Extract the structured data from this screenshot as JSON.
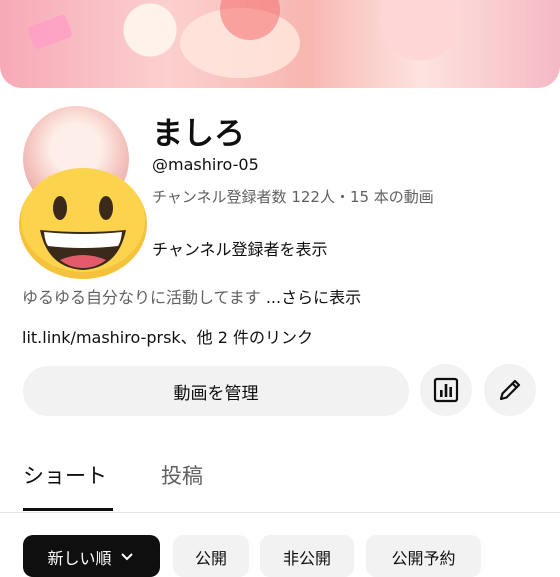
{
  "channel": {
    "name": "ましろ",
    "handle": "@mashiro-05",
    "stats": "チャンネル登録者数 122人・15 本の動画",
    "subscribers_link": "チャンネル登録者を表示",
    "description": "ゆるゆる自分なりに活動してます",
    "description_more": "...さらに表示",
    "link_text": "lit.link/mashiro-prsk",
    "link_more": "、他 2 件のリンク"
  },
  "actions": {
    "manage_videos": "動画を管理",
    "analytics_icon": "bar-chart-icon",
    "edit_icon": "pencil-icon"
  },
  "tabs": [
    {
      "label": "ショート",
      "active": true
    },
    {
      "label": "投稿",
      "active": false
    }
  ],
  "filter_chips": [
    {
      "label": "新しい順",
      "selected": true,
      "icon": "chevron-down-icon"
    },
    {
      "label": "公開",
      "selected": false
    },
    {
      "label": "非公開",
      "selected": false
    },
    {
      "label": "公開予約",
      "selected": false
    }
  ],
  "colors": {
    "primary_text": "#0f0f0f",
    "secondary_text": "#606060",
    "button_bg": "#f2f2f2",
    "selected_chip_bg": "#0f0f0f"
  }
}
